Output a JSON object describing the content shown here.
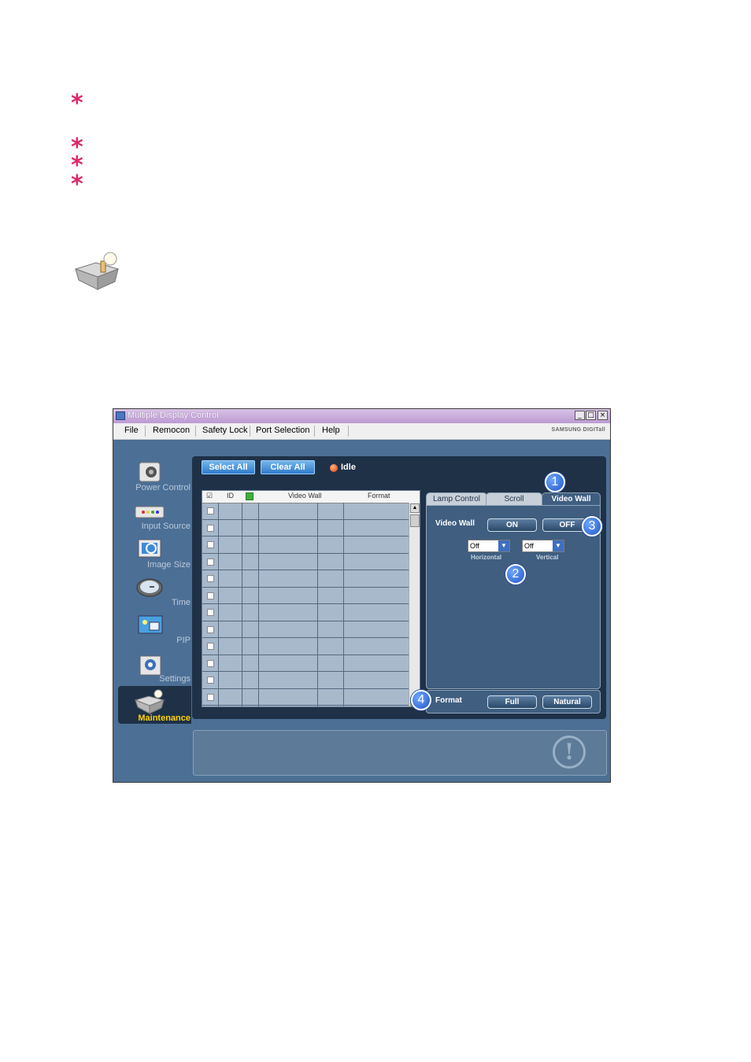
{
  "window": {
    "title": "Multiple Display Control",
    "min_btn": "_",
    "max_btn": "□",
    "close_btn": "×",
    "brand": "SAMSUNG DIGITall"
  },
  "menu": [
    "File",
    "Remocon",
    "Safety Lock",
    "Port Selection",
    "Help"
  ],
  "sidebar": {
    "items": [
      {
        "label": "Power Control",
        "icon": "power-control-icon"
      },
      {
        "label": "Input Source",
        "icon": "input-source-icon"
      },
      {
        "label": "Image Size",
        "icon": "image-size-icon"
      },
      {
        "label": "Time",
        "icon": "clock-icon"
      },
      {
        "label": "PIP",
        "icon": "pip-icon"
      },
      {
        "label": "Settings",
        "icon": "settings-icon"
      },
      {
        "label": "Maintenance",
        "icon": "maintenance-icon",
        "active": true
      }
    ]
  },
  "toolbar": {
    "select_all": "Select All",
    "clear_all": "Clear All",
    "status": "Idle"
  },
  "grid": {
    "headers": [
      "☑",
      "ID",
      "",
      "Video Wall",
      "Format"
    ],
    "row_count": 12
  },
  "tabs": [
    {
      "label": "Lamp Control",
      "active": false
    },
    {
      "label": "Scroll",
      "active": false
    },
    {
      "label": "Video Wall",
      "active": true
    }
  ],
  "video_wall": {
    "label": "Video Wall",
    "on": "ON",
    "off": "OFF",
    "horizontal": {
      "value": "Off",
      "label": "Horizontal"
    },
    "vertical": {
      "value": "Off",
      "label": "Vertical"
    }
  },
  "format": {
    "label": "Format",
    "full": "Full",
    "natural": "Natural"
  },
  "callouts": [
    "1",
    "2",
    "3",
    "4"
  ],
  "colors": {
    "asterisk": "#e0266a",
    "window_bg": "#4c6f95",
    "panel_dark": "#1e3147",
    "accent_blue": "#2f7ccb"
  }
}
